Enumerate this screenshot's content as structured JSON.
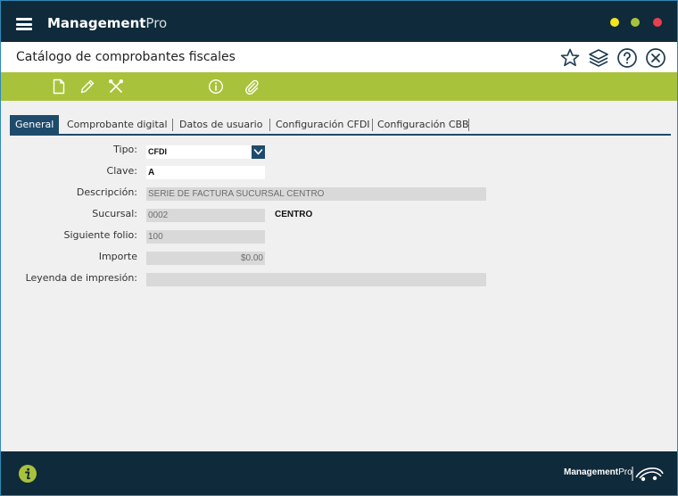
{
  "app": {
    "brand_bold": "Management",
    "brand_light": "Pro"
  },
  "header": {
    "title": "Catálogo de comprobantes fiscales"
  },
  "tabs": [
    {
      "label": "General"
    },
    {
      "label": "Comprobante digital"
    },
    {
      "label": "Datos de usuario"
    },
    {
      "label": "Configuración CFDI"
    },
    {
      "label": "Configuración CBB"
    }
  ],
  "form": {
    "tipo": {
      "label": "Tipo:",
      "value": "CFDI"
    },
    "clave": {
      "label": "Clave:",
      "value": "A"
    },
    "descripcion": {
      "label": "Descripción:",
      "value": "SERIE DE FACTURA SUCURSAL CENTRO"
    },
    "sucursal": {
      "label": "Sucursal:",
      "value": "0002",
      "name": "CENTRO"
    },
    "siguiente_folio": {
      "label": "Siguiente folio:",
      "value": "100"
    },
    "importe": {
      "label": "Importe",
      "value": "$0.00"
    },
    "leyenda": {
      "label": "Leyenda de impresión:",
      "value": ""
    }
  },
  "footer": {
    "brand_bold": "Management",
    "brand_light": "Pro"
  },
  "colors": {
    "titlebar": "#0f2a3a",
    "toolbar": "#a9c23c",
    "tab_active": "#1e4b6c",
    "window_yellow": "#f4e51c",
    "window_green": "#a9c23c",
    "window_red": "#e8414d"
  }
}
